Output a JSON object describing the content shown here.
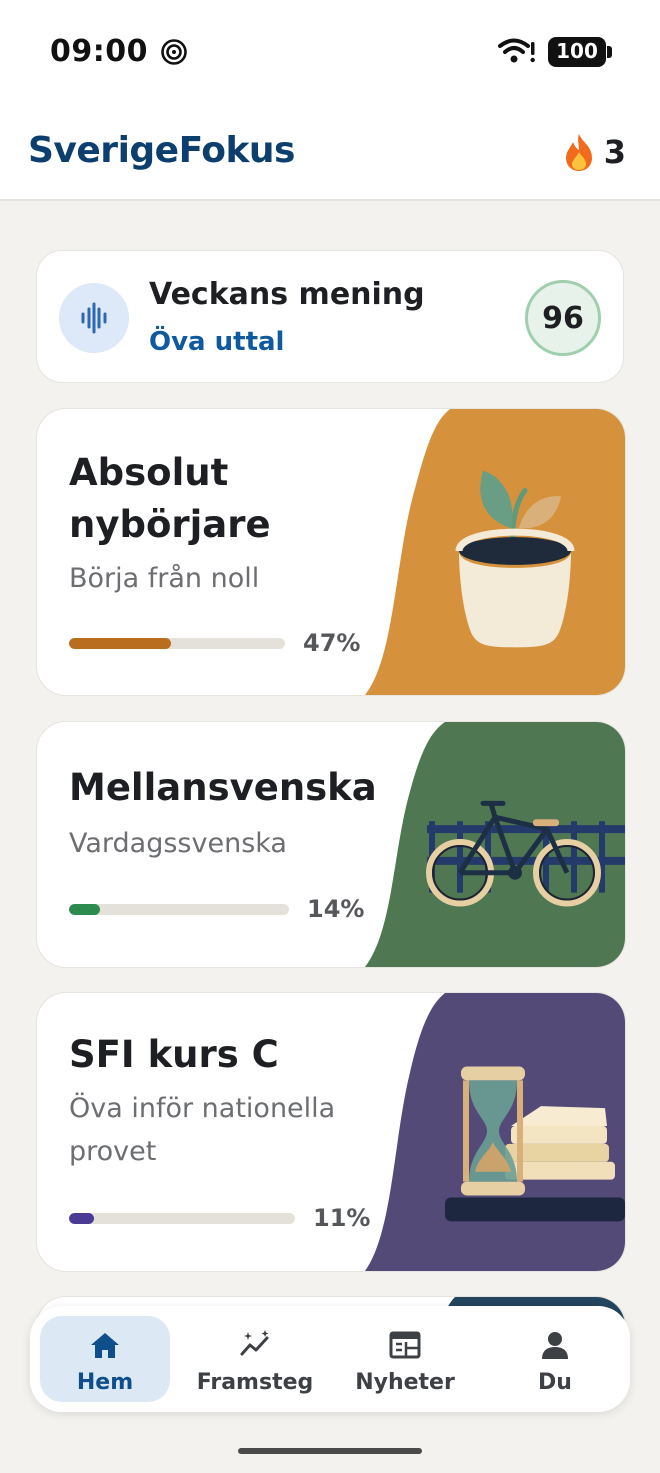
{
  "status_bar": {
    "time": "09:00",
    "battery": "100",
    "icons": [
      "spiral-icon",
      "wifi-icon",
      "battery-icon"
    ]
  },
  "header": {
    "title": "SverigeFokus",
    "streak_count": "3",
    "streak_icon": "flame-icon"
  },
  "weekly": {
    "title": "Veckans mening",
    "link": "Öva uttal",
    "score": "96",
    "icon": "soundwave-icon"
  },
  "courses": [
    {
      "title_line1": "Absolut",
      "title_line2": "nybörjare",
      "subtitle": "Börja från noll",
      "progress": 0.47,
      "progress_label": "47%",
      "color": "#b86e1e",
      "art_bg": "#d5913b",
      "art": "plant-pot-illustration"
    },
    {
      "title": "Mellansvenska",
      "subtitle": "Vardagssvenska",
      "progress": 0.14,
      "progress_label": "14%",
      "color": "#2e8b4f",
      "art_bg": "#4f7751",
      "art": "bicycle-illustration"
    },
    {
      "title": "SFI kurs C",
      "subtitle_line1": "Öva inför nationella",
      "subtitle_line2": "provet",
      "progress": 0.11,
      "progress_label": "11%",
      "color": "#4b3a96",
      "art_bg": "#534a78",
      "art": "hourglass-books-illustration"
    }
  ],
  "nav": {
    "items": [
      {
        "label": "Hem",
        "icon": "home-icon",
        "active": true
      },
      {
        "label": "Framsteg",
        "icon": "trend-sparkle-icon",
        "active": false
      },
      {
        "label": "Nyheter",
        "icon": "newspaper-icon",
        "active": false
      },
      {
        "label": "Du",
        "icon": "person-icon",
        "active": false
      }
    ]
  }
}
